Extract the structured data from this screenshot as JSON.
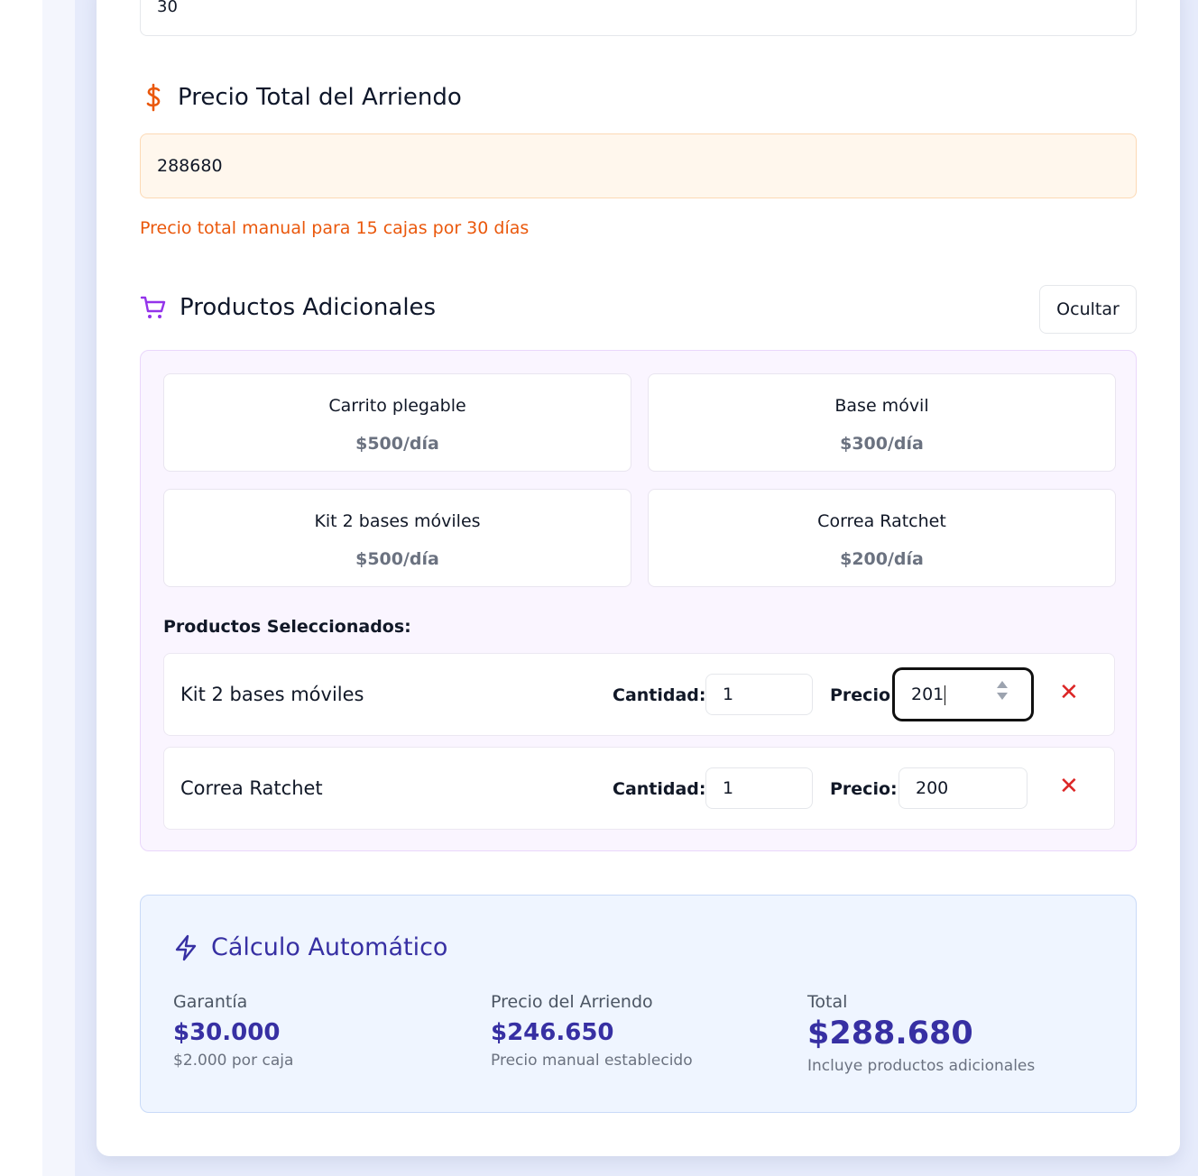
{
  "top_field": {
    "value": "30"
  },
  "total_price_section": {
    "title": "Precio Total del Arriendo",
    "value": "288680",
    "note": "Precio total manual para 15 cajas por 30 días"
  },
  "additional_products": {
    "title": "Productos Adicionales",
    "hide_button": "Ocultar",
    "catalog": [
      {
        "name": "Carrito plegable",
        "price": "$500/día"
      },
      {
        "name": "Base móvil",
        "price": "$300/día"
      },
      {
        "name": "Kit 2 bases móviles",
        "price": "$500/día"
      },
      {
        "name": "Correa Ratchet",
        "price": "$200/día"
      }
    ],
    "selected_title": "Productos Seleccionados:",
    "quantity_label": "Cantidad:",
    "price_label": "Precio:",
    "selected": [
      {
        "name": "Kit 2 bases móviles",
        "quantity": "1",
        "price": "201"
      },
      {
        "name": "Correa Ratchet",
        "quantity": "1",
        "price": "200"
      }
    ]
  },
  "auto_calc": {
    "title": "Cálculo Automático",
    "guarantee": {
      "label": "Garantía",
      "value": "$30.000",
      "sub": "$2.000 por caja"
    },
    "rent": {
      "label": "Precio del Arriendo",
      "value": "$246.650",
      "sub": "Precio manual establecido"
    },
    "total": {
      "label": "Total",
      "value": "$288.680",
      "sub": "Incluye productos adicionales"
    }
  },
  "colors": {
    "accent_orange": "#ea580c",
    "accent_purple": "#9333ea",
    "accent_indigo": "#3730a3",
    "remove_red": "#dc2626"
  }
}
